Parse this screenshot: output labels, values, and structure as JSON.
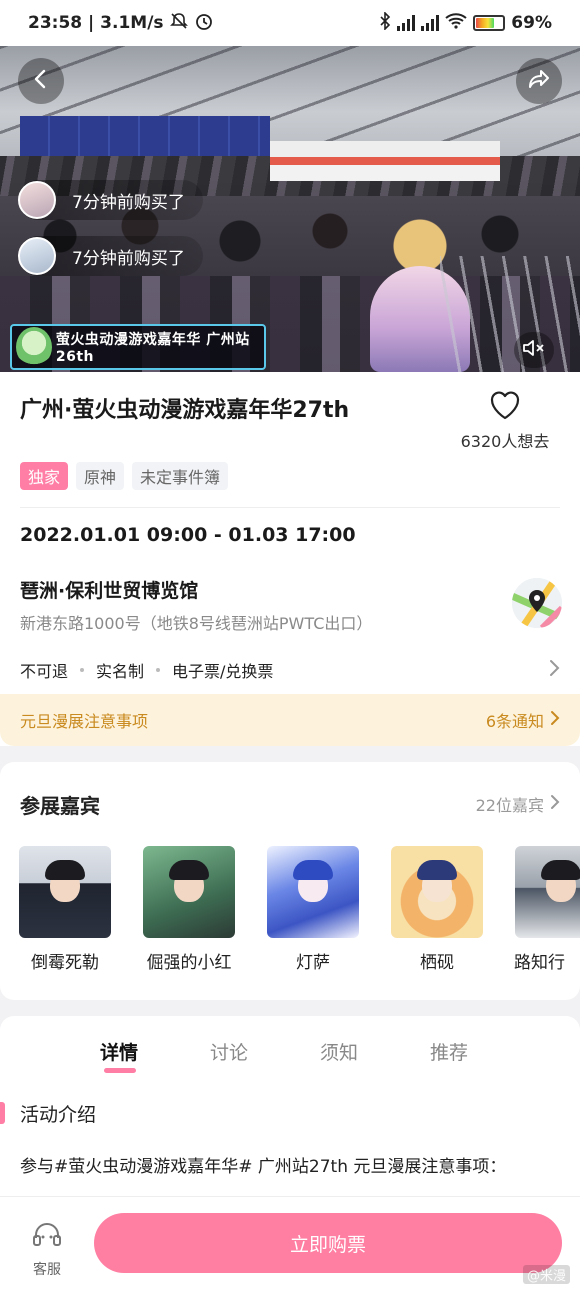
{
  "status_bar": {
    "time_speed": "23:58 | 3.1M/s",
    "battery_percent": "69%",
    "battery_level": 0.69
  },
  "hero": {
    "recent_purchases": [
      {
        "text": "7分钟前购买了"
      },
      {
        "text": "7分钟前购买了"
      }
    ],
    "logo_text": "萤火虫动漫游戏嘉年华 广州站26th"
  },
  "event": {
    "title": "广州·萤火虫动漫游戏嘉年华27th",
    "want_count": "6320人想去",
    "tags": [
      "独家",
      "原神",
      "未定事件簿"
    ],
    "datetime": "2022.01.01 09:00 - 01.03 17:00",
    "venue_name": "琶洲·保利世贸博览馆",
    "venue_address": "新港东路1000号（地铁8号线琶洲站PWTC出口）",
    "policies": [
      "不可退",
      "实名制",
      "电子票/兑换票"
    ],
    "notice_label": "元旦漫展注意事项",
    "notice_count": "6条通知"
  },
  "guests": {
    "heading": "参展嘉宾",
    "count": "22位嘉宾",
    "items": [
      {
        "name": "倒霉死勒"
      },
      {
        "name": "倔强的小红"
      },
      {
        "name": "灯萨"
      },
      {
        "name": "栖砚"
      },
      {
        "name": "路知行"
      }
    ]
  },
  "tabs": [
    "详情",
    "讨论",
    "须知",
    "推荐"
  ],
  "detail": {
    "section_title": "活动介绍",
    "intro_text": "参与#萤火虫动漫游戏嘉年华# 广州站27th 元旦漫展注意事项："
  },
  "bottom": {
    "service_label": "客服",
    "buy_label": "立即购票",
    "watermark": "@米漫"
  },
  "colors": {
    "accent_pink": "#ff7fa3",
    "notice_text": "#c98a1f",
    "notice_bg": "#fdf3dc"
  }
}
